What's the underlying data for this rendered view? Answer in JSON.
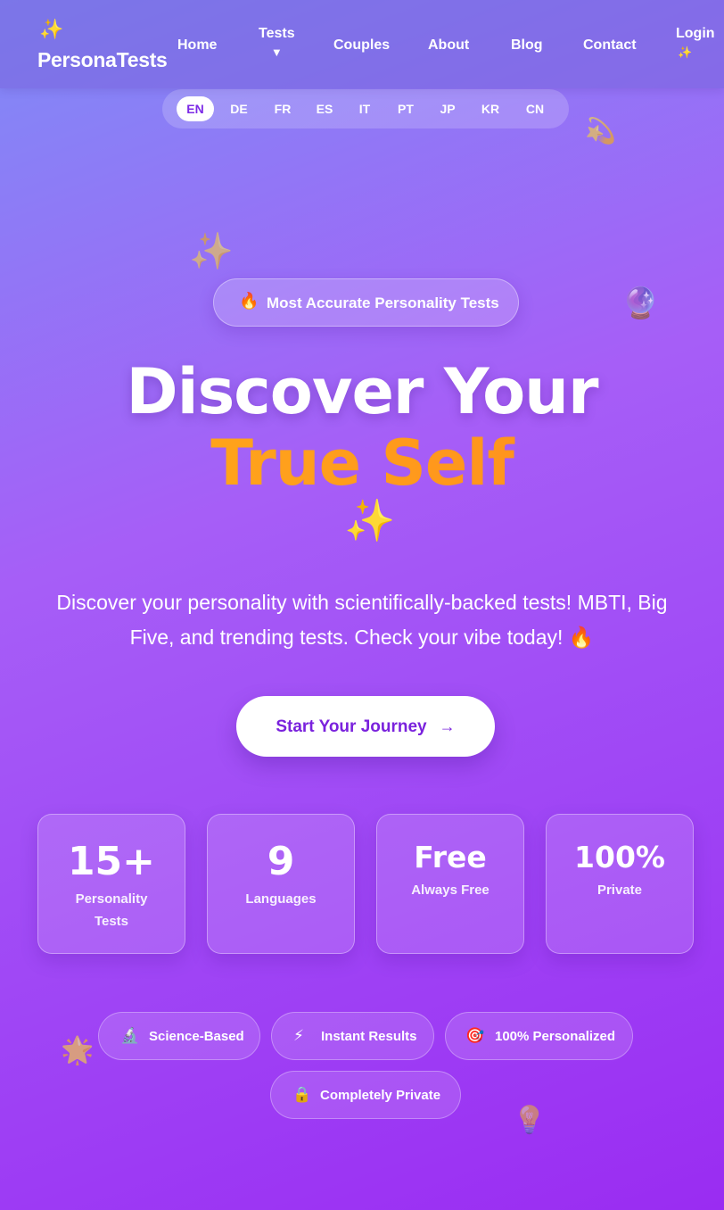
{
  "header": {
    "logo_icon": "✨",
    "logo_text": "PersonaTests",
    "nav": {
      "home": "Home",
      "tests": "Tests",
      "tests_caret": "▼",
      "couples": "Couples",
      "about": "About",
      "blog": "Blog",
      "contact": "Contact",
      "login": "Login",
      "login_icon": "✨"
    }
  },
  "languages": {
    "items": [
      "EN",
      "DE",
      "FR",
      "ES",
      "IT",
      "PT",
      "JP",
      "KR",
      "CN"
    ],
    "selected": "EN"
  },
  "hero": {
    "badge_icon": "🔥",
    "badge_text": "Most Accurate Personality Tests",
    "title_line1": "Discover Your",
    "title_line2": "True Self",
    "title_icon": "✨",
    "subtitle": "Discover your personality with scientifically-backed tests! MBTI, Big Five, and trending tests. Check your vibe today! 🔥",
    "cta_label": "Start Your Journey",
    "cta_arrow": "→"
  },
  "stats": [
    {
      "value": "15+",
      "label": "Personality Tests"
    },
    {
      "value": "9",
      "label": "Languages"
    },
    {
      "value": "Free",
      "label": "Always Free"
    },
    {
      "value": "100%",
      "label": "Private"
    }
  ],
  "features": [
    {
      "icon": "🔬",
      "label": "Science-Based"
    },
    {
      "icon": "⚡",
      "label": "Instant Results"
    },
    {
      "icon": "🎯",
      "label": "100% Personalized"
    },
    {
      "icon": "🔒",
      "label": "Completely Private"
    }
  ],
  "decorations": {
    "sparkle_left": "✨",
    "crystal_ball": "🔮",
    "ring": "💫",
    "star": "🌟",
    "bulb": "💡"
  },
  "colors": {
    "accent": "#7c2ae6",
    "title_highlight": "#ffa215"
  }
}
